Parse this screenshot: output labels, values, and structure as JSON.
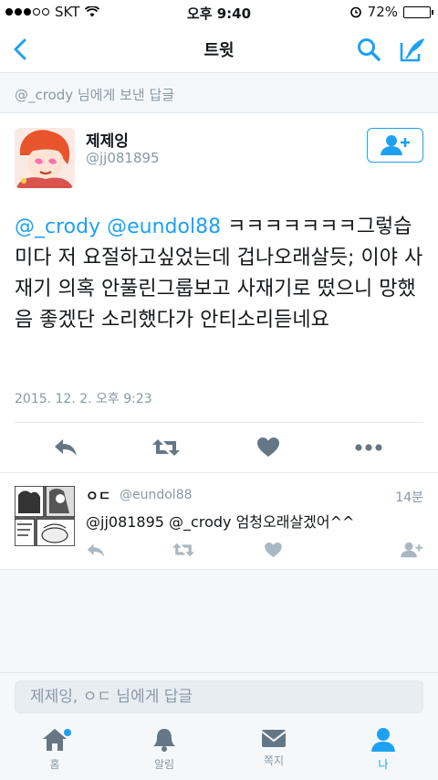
{
  "status_bar": {
    "carrier": "SKT",
    "time": "오후 9:40",
    "battery_text": "72%",
    "battery_level": 0.72
  },
  "nav": {
    "title": "트윗"
  },
  "reply_context": "@_crody 님에게 보낸 답글",
  "tweet": {
    "author_name": "제제잉",
    "author_handle": "@jj081895",
    "mention_1": "@_crody",
    "mention_2": "@eundol88",
    "body": "ㅋㅋㅋㅋㅋㅋㅋ그렇습미다  저 요절하고싶었는데 겁나오래살듯; 이야 사재기 의혹 안풀린그룹보고 사재기로 떴으니 망했음 좋겠단 소리했다가 안티소리듣네요",
    "date": "2015. 12. 2. 오후 9:23"
  },
  "reply": {
    "author_name": "ㅇㄷ",
    "author_handle": "@eundol88",
    "time": "14분",
    "text": "@jj081895 @_crody 엄청오래살겠어^^"
  },
  "composer": {
    "placeholder": "제제잉, ㅇㄷ 님에게 답글"
  },
  "tabs": [
    {
      "label": "홈",
      "icon": "home-icon"
    },
    {
      "label": "알림",
      "icon": "bell-icon"
    },
    {
      "label": "쪽지",
      "icon": "envelope-icon"
    },
    {
      "label": "나",
      "icon": "person-icon"
    }
  ],
  "colors": {
    "accent": "#1da1f2",
    "muted": "#8899a6",
    "icon_gray": "#657786",
    "light_icon": "#aab8c2"
  }
}
